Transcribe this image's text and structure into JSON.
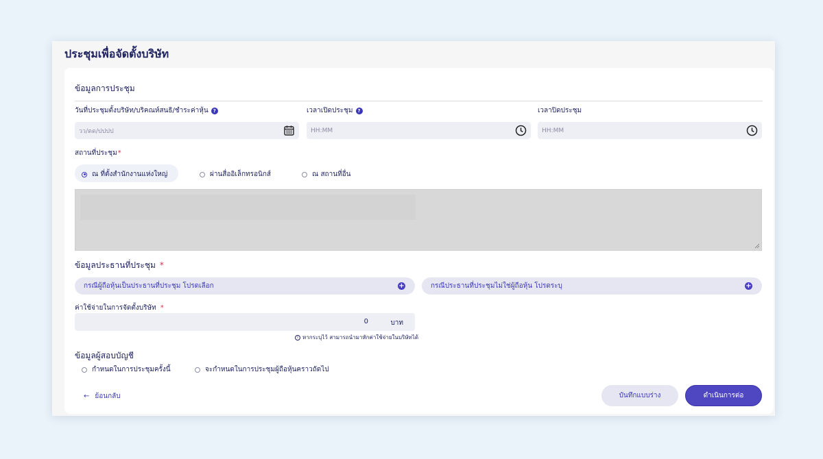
{
  "page": {
    "title": "ประชุมเพื่อจัดตั้งบริษัท"
  },
  "meeting_info": {
    "section_title": "ข้อมูลการประชุม",
    "date_label": "วันที่ประชุมตั้งบริษัท/บริคณห์สนธิ/ชำระค่าหุ้น",
    "date_placeholder": "วว/ดด/ปปปป",
    "open_time_label": "เวลาเปิดประชุม",
    "open_time_placeholder": "HH:MM",
    "close_time_label": "เวลาปิดประชุม",
    "close_time_placeholder": "HH:MM",
    "venue_label": "สถานที่ประชุม",
    "required_mark": "*",
    "venue_options": [
      {
        "label": "ณ ที่ตั้งสำนักงานแห่งใหญ่",
        "selected": true
      },
      {
        "label": "ผ่านสื่ออิเล็กทรอนิกส์",
        "selected": false
      },
      {
        "label": "ณ สถานที่อื่น",
        "selected": false
      }
    ]
  },
  "chairman": {
    "section_title": "ข้อมูลประธานที่ประชุม",
    "required_mark": "*",
    "select_shareholder": "กรณีผู้ถือหุ้นเป็นประธานที่ประชุม โปรดเลือก",
    "specify_non_shareholder": "กรณีประธานที่ประชุมไม่ใช่ผู้ถือหุ้น โปรดระบุ"
  },
  "expense": {
    "label": "ค่าใช้จ่ายในการจัดตั้งบริษัท",
    "required_mark": "*",
    "value": "0",
    "unit": "บาท",
    "note": "หากระบุไว้ สามารถนำมาหักค่าใช้จ่ายในบริษัทได้"
  },
  "auditor": {
    "section_title": "ข้อมูลผู้สอบบัญชี",
    "options": [
      {
        "label": "กำหนดในการประชุมครั้งนี้",
        "selected": false
      },
      {
        "label": "จะกำหนดในการประชุมผู้ถือหุ้นคราวถัดไป",
        "selected": false
      }
    ]
  },
  "footer": {
    "back_label": "ย้อนกลับ",
    "save_draft_label": "บันทึกแบบร่าง",
    "continue_label": "ดำเนินการต่อ"
  },
  "colors": {
    "accent": "#3a36b8",
    "primary_button": "#4f46c2",
    "background": "#eaf3fa"
  }
}
